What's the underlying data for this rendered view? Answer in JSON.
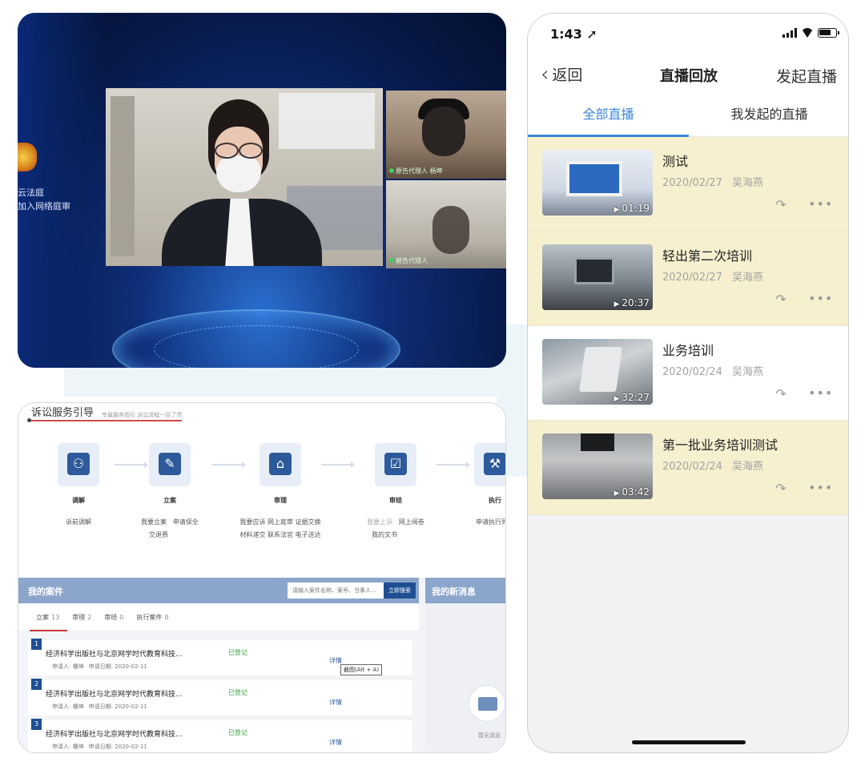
{
  "conference": {
    "side_text_line1": "云法庭",
    "side_text_line2": "加入网络庭审",
    "tile1_label": "原告代理人 杨坤",
    "tile2_label": "被告代理人"
  },
  "portal": {
    "title": "诉讼服务引导",
    "subtitle": "专属服务指引 诉讼流程一目了然",
    "steps": [
      {
        "name": "调解",
        "links": [
          "诉前调解"
        ]
      },
      {
        "name": "立案",
        "links": [
          "我要立案",
          "申请保全",
          "交退费"
        ]
      },
      {
        "name": "审理",
        "links": [
          "我要应诉",
          "网上庭审",
          "证据交换",
          "材料递交",
          "联系法官",
          "电子送达"
        ]
      },
      {
        "name": "审结",
        "links": [
          "我要上诉",
          "网上阅卷",
          "我的文书"
        ]
      },
      {
        "name": "执行",
        "links": [
          "申请执行异议"
        ]
      }
    ],
    "cases": {
      "title": "我的案件",
      "search_placeholder": "请输入案件名称、案号、当事人...",
      "search_button": "立即搜索",
      "tabs": [
        {
          "label": "立案",
          "count": "13"
        },
        {
          "label": "审理",
          "count": "2"
        },
        {
          "label": "审结",
          "count": "0"
        },
        {
          "label": "执行案件",
          "count": "0"
        }
      ],
      "items": [
        {
          "num": "1",
          "title": "经济科学出版社与北京网学时代教育科技...",
          "applicant": "申请人: 樓坤",
          "date": "申请日期: 2020-02-11",
          "status": "已登记",
          "detail": "详情"
        },
        {
          "num": "2",
          "title": "经济科学出版社与北京网学时代教育科技...",
          "applicant": "申请人: 樓坤",
          "date": "申请日期: 2020-02-11",
          "status": "已登记",
          "detail": "详情"
        },
        {
          "num": "3",
          "title": "经济科学出版社与北京网学时代教育科技...",
          "applicant": "申请人: 樓坤",
          "date": "申请日期: 2020-02-11",
          "status": "已登记",
          "detail": "详情"
        }
      ],
      "tooltip": "截图(Alt + A)"
    },
    "messages": {
      "title": "我的新消息",
      "empty": "暂无消息"
    }
  },
  "phone": {
    "status_time": "1:43 ➚",
    "nav": {
      "back": "返回",
      "title": "直播回放",
      "action": "发起直播"
    },
    "tabs": [
      "全部直播",
      "我发起的直播"
    ],
    "items": [
      {
        "title": "测试",
        "date": "2020/02/27",
        "author": "吴海燕",
        "duration": "01:19",
        "highlight": true
      },
      {
        "title": "轻出第二次培训",
        "date": "2020/02/27",
        "author": "吴海燕",
        "duration": "20:37",
        "highlight": true
      },
      {
        "title": "业务培训",
        "date": "2020/02/24",
        "author": "吴海燕",
        "duration": "32:27",
        "highlight": false
      },
      {
        "title": "第一批业务培训测试",
        "date": "2020/02/24",
        "author": "吴海燕",
        "duration": "03:42",
        "highlight": true
      }
    ],
    "share_icon": "↷",
    "more_icon": "•••"
  }
}
